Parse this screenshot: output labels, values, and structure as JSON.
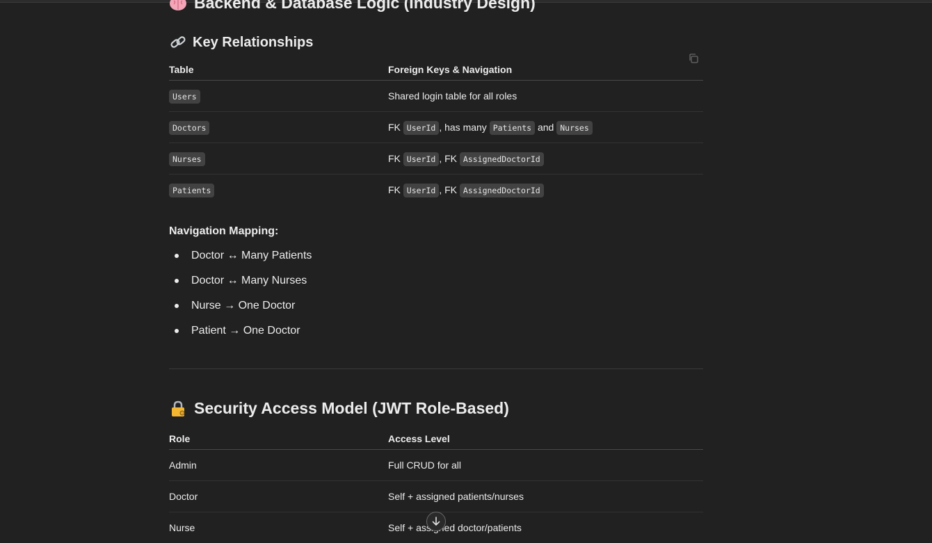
{
  "section1": {
    "title": "Backend & Database Logic (Industry Design)",
    "icon": "brain-icon"
  },
  "relationships": {
    "title": "Key Relationships",
    "icon": "link-icon",
    "headers": [
      "Table",
      "Foreign Keys & Navigation"
    ],
    "rows": [
      {
        "table": "Users",
        "desc": "Shared login table for all roles"
      },
      {
        "table": "Doctors",
        "fk": "FK",
        "c1": "UserId",
        "t1": ", has many",
        "c2": "Patients",
        "t2": "and",
        "c3": "Nurses"
      },
      {
        "table": "Nurses",
        "fk": "FK",
        "c1": "UserId",
        "t1": ", FK",
        "c2": "AssignedDoctorId"
      },
      {
        "table": "Patients",
        "fk": "FK",
        "c1": "UserId",
        "t1": ", FK",
        "c2": "AssignedDoctorId"
      }
    ]
  },
  "navigation": {
    "title": "Navigation Mapping:",
    "items": [
      "Doctor ↔ Many Patients",
      "Doctor ↔ Many Nurses",
      "Nurse → One Doctor",
      "Patient → One Doctor"
    ]
  },
  "security": {
    "title": "Security Access Model (JWT Role-Based)",
    "icon": "locked-with-key-icon",
    "headers": [
      "Role",
      "Access Level"
    ],
    "rows": [
      {
        "role": "Admin",
        "access": "Full CRUD for all"
      },
      {
        "role": "Doctor",
        "access": "Self + assigned patients/nurses"
      },
      {
        "role": "Nurse",
        "access": "Self + assigned doctor/patients"
      }
    ]
  },
  "scroll_button": {
    "icon": "arrow-down-icon"
  },
  "copy_button": {
    "icon": "copy-icon"
  }
}
